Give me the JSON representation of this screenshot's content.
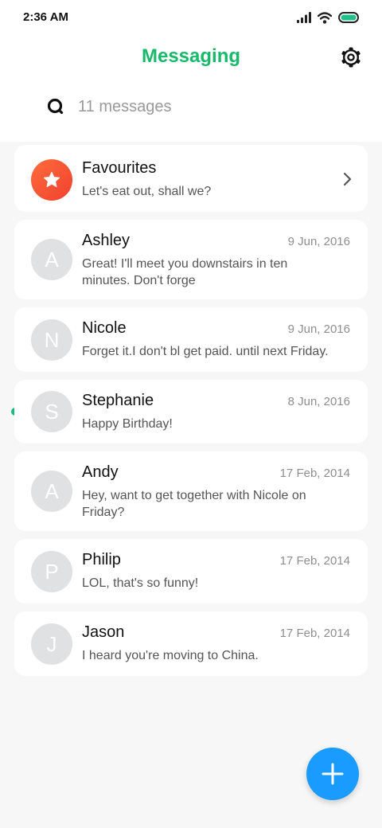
{
  "status_bar": {
    "time": "2:36 AM"
  },
  "header": {
    "title": "Messaging"
  },
  "search": {
    "text": "11 messages"
  },
  "favourites": {
    "title": "Favourites",
    "preview": "Let's eat out, shall we?"
  },
  "conversations": [
    {
      "initial": "A",
      "name": "Ashley",
      "date": "9 Jun, 2016",
      "preview": "Great! I'll meet you downstairs in ten minutes. Don't forge"
    },
    {
      "initial": "N",
      "name": "Nicole",
      "date": "9 Jun, 2016",
      "preview": "Forget it.I don't bl get paid. until next Friday."
    },
    {
      "initial": "S",
      "name": "Stephanie",
      "date": "8 Jun, 2016",
      "preview": "Happy Birthday!",
      "unread": true
    },
    {
      "initial": "A",
      "name": "Andy",
      "date": "17 Feb, 2014",
      "preview": "Hey, want to get together with Nicole on Friday?"
    },
    {
      "initial": "P",
      "name": "Philip",
      "date": "17 Feb, 2014",
      "preview": "LOL, that's so funny!"
    },
    {
      "initial": "J",
      "name": "Jason",
      "date": "17 Feb, 2014",
      "preview": "I heard you're moving to China."
    }
  ],
  "colors": {
    "accent": "#19b96b",
    "fab": "#1a9bff",
    "unread_dot": "#1fb877",
    "favourites": "#f0402f"
  },
  "icons": {
    "settings": "gear-icon",
    "search": "search-icon",
    "favourites": "star-icon",
    "open": "chevron-right-icon",
    "compose": "plus-icon"
  }
}
